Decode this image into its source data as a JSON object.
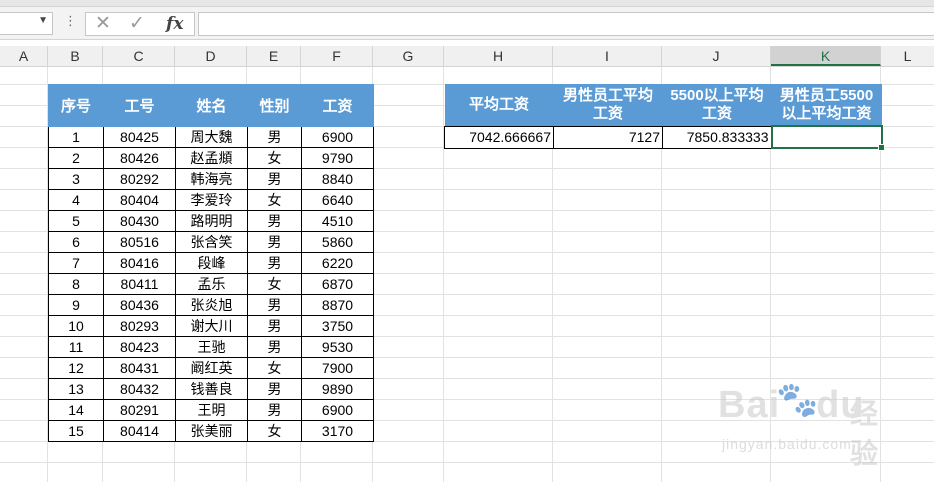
{
  "formula_bar": {
    "name_box": "",
    "formula": "",
    "fx_label": "fx"
  },
  "columns": [
    "A",
    "B",
    "C",
    "D",
    "E",
    "F",
    "G",
    "H",
    "I",
    "J",
    "K",
    "L"
  ],
  "selected_column": "K",
  "left_table": {
    "headers": [
      "序号",
      "工号",
      "姓名",
      "性别",
      "工资"
    ],
    "rows": [
      [
        "1",
        "80425",
        "周大魏",
        "男",
        "6900"
      ],
      [
        "2",
        "80426",
        "赵孟頫",
        "女",
        "9790"
      ],
      [
        "3",
        "80292",
        "韩海亮",
        "男",
        "8840"
      ],
      [
        "4",
        "80404",
        "李爱玲",
        "女",
        "6640"
      ],
      [
        "5",
        "80430",
        "路明明",
        "男",
        "4510"
      ],
      [
        "6",
        "80516",
        "张含笑",
        "男",
        "5860"
      ],
      [
        "7",
        "80416",
        "段峰",
        "男",
        "6220"
      ],
      [
        "8",
        "80411",
        "孟乐",
        "女",
        "6870"
      ],
      [
        "9",
        "80436",
        "张炎旭",
        "男",
        "8870"
      ],
      [
        "10",
        "80293",
        "谢大川",
        "男",
        "3750"
      ],
      [
        "11",
        "80423",
        "王驰",
        "男",
        "9530"
      ],
      [
        "12",
        "80431",
        "阚红英",
        "女",
        "7900"
      ],
      [
        "13",
        "80432",
        "钱善良",
        "男",
        "9890"
      ],
      [
        "14",
        "80291",
        "王明",
        "男",
        "6900"
      ],
      [
        "15",
        "80414",
        "张美丽",
        "女",
        "3170"
      ]
    ]
  },
  "right_table": {
    "headers": [
      [
        "平均工资"
      ],
      [
        "男性员工平均",
        "工资"
      ],
      [
        "5500以上平均",
        "工资"
      ],
      [
        "男性员工5500",
        "以上平均工资"
      ]
    ],
    "values": [
      "7042.666667",
      "7127",
      "7850.833333",
      ""
    ]
  },
  "watermark": {
    "brand": "Bai",
    "brand_tail": "du",
    "cn": "经验",
    "url": "jingyan.baidu.com"
  },
  "colors": {
    "header_blue": "#5b9bd5",
    "excel_green": "#217346"
  }
}
